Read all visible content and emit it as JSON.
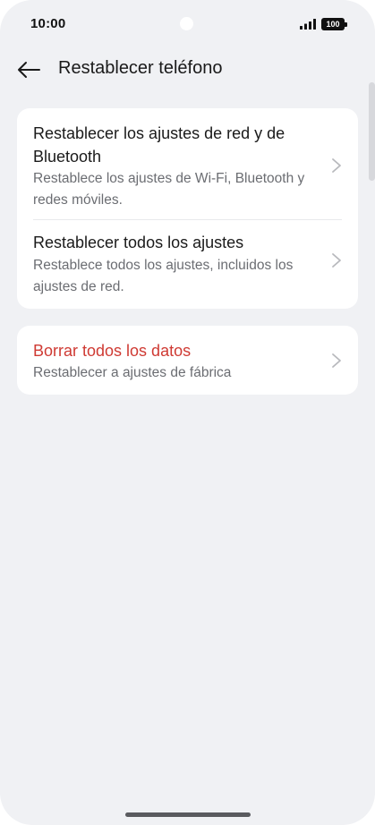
{
  "status_bar": {
    "time": "10:00",
    "battery": "100"
  },
  "header": {
    "back_icon": "arrow-left-icon",
    "title": "Restablecer teléfono"
  },
  "sections": [
    {
      "items": [
        {
          "title": "Restablecer los ajustes de red y de Bluetooth",
          "subtitle": "Restablece los ajustes de Wi-Fi, Bluetooth y redes móviles."
        },
        {
          "title": "Restablecer todos los ajustes",
          "subtitle": "Restablece todos los ajustes, incluidos los ajustes de red."
        }
      ]
    },
    {
      "items": [
        {
          "title": "Borrar todos los datos",
          "subtitle": "Restablecer a ajustes de fábrica",
          "color": "#cf3a33"
        }
      ]
    }
  ],
  "colors": {
    "background": "#f0f1f4",
    "card": "#ffffff",
    "text_primary": "#1a1a1a",
    "text_secondary": "#6b6d72",
    "danger": "#cf3a33",
    "chevron": "#b8b9bd"
  }
}
